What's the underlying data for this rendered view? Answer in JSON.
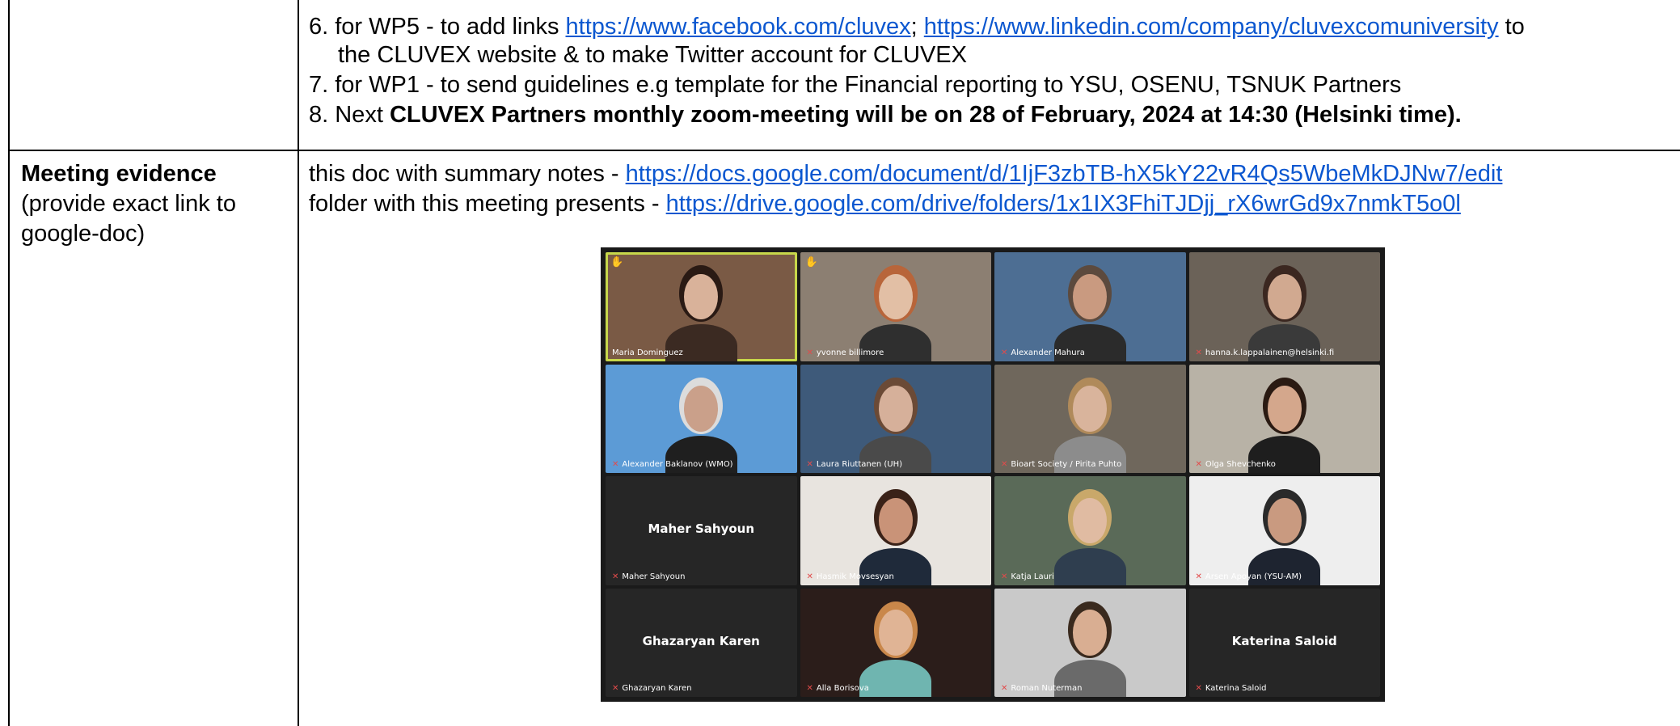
{
  "action_items": {
    "item6_prefix": "6. for WP5 - to add links ",
    "item6_link1": "https://www.facebook.com/cluvex",
    "item6_sep": "; ",
    "item6_link2": "https://www.linkedin.com/company/cluvexcomuniversity",
    "item6_suffix": " to",
    "item6_line2": "the CLUVEX website & to make Twitter account for CLUVEX",
    "item7": "7. for WP1 - to send guidelines e.g  template for the Financial reporting to YSU, OSENU, TSNUK Partners",
    "item8_prefix": "8. Next ",
    "item8_bold": "CLUVEX Partners monthly zoom-meeting will be on 28 of February, 2024 at 14:30 (Helsinki time)."
  },
  "evidence": {
    "label_bold": "Meeting evidence",
    "label_line2": "(provide exact link to",
    "label_line3": "google-doc)",
    "doc_prefix": "this doc with summary notes - ",
    "doc_link": "https://docs.google.com/document/d/1IjF3zbTB-hX5kY22vR4Qs5WbeMkDJNw7/edit",
    "folder_prefix": "folder with this meeting presents - ",
    "folder_link": "https://drive.google.com/drive/folders/1x1IX3FhiTJDjj_rX6wrGd9x7nmkT5o0l"
  },
  "zoom_participants": [
    {
      "name": "Maria Dominguez",
      "hand": true,
      "bg": "#7a5a45",
      "skin": "#d9b29a",
      "cloth": "#3b2a22",
      "hair": "#2a1a14"
    },
    {
      "name": "yvonne billimore",
      "hand": true,
      "bg": "#8c7f72",
      "skin": "#e2bfa5",
      "cloth": "#2f2f2f",
      "hair": "#b8653a"
    },
    {
      "name": "Alexander Mahura",
      "hand": false,
      "bg": "#4d6e93",
      "skin": "#c99a80",
      "cloth": "#2b2b2b",
      "hair": "#5c4a3e"
    },
    {
      "name": "hanna.k.lappalainen@helsinki.fi",
      "hand": false,
      "bg": "#6b6258",
      "skin": "#d1a990",
      "cloth": "#3a3a3a",
      "hair": "#3b2720"
    },
    {
      "name": "Alexander Baklanov (WMO)",
      "hand": false,
      "bg": "#5c9bd6",
      "skin": "#caa08a",
      "cloth": "#1f1f1f",
      "hair": "#dcdcdc"
    },
    {
      "name": "Laura Riuttanen (UH)",
      "hand": false,
      "bg": "#3e5a7a",
      "skin": "#d6b09a",
      "cloth": "#4a4a4a",
      "hair": "#6b4a36"
    },
    {
      "name": "Bioart Society / Pirita Puhto",
      "hand": false,
      "bg": "#6f675c",
      "skin": "#d9b49c",
      "cloth": "#8c8c8c",
      "hair": "#b08a5a"
    },
    {
      "name": "Olga Shevchenko",
      "hand": false,
      "bg": "#b8b2a6",
      "skin": "#d4a78c",
      "cloth": "#1e1e1e",
      "hair": "#2a1a12"
    },
    {
      "name": "Maher Sahyoun",
      "hand": false,
      "center": "Maher Sahyoun"
    },
    {
      "name": "Hasmik Movsesyan",
      "hand": false,
      "bg": "#e8e4df",
      "skin": "#c99378",
      "cloth": "#1f2a3a",
      "hair": "#3a2218"
    },
    {
      "name": "Katja Lauri",
      "hand": false,
      "bg": "#5a6a58",
      "skin": "#e0bba2",
      "cloth": "#2f3e4f",
      "hair": "#c9a86a"
    },
    {
      "name": "Arsen Apoyan (YSU-AM)",
      "hand": false,
      "bg": "#eeeeee",
      "skin": "#c99a80",
      "cloth": "#1e2430",
      "hair": "#2a2a2a"
    },
    {
      "name": "Ghazaryan Karen",
      "hand": false,
      "center": "Ghazaryan Karen"
    },
    {
      "name": "Alla Borisova",
      "hand": false,
      "bg": "#2b1d1a",
      "skin": "#e0b495",
      "cloth": "#6fb5b0",
      "hair": "#c9874a"
    },
    {
      "name": "Roman Nuterman",
      "hand": false,
      "bg": "#c9c9c9",
      "skin": "#d9ae92",
      "cloth": "#6a6a6a",
      "hair": "#3a2a1e"
    },
    {
      "name": "Katerina Saloid",
      "hand": false,
      "center": "Katerina Saloid"
    }
  ],
  "colors": {
    "link": "#0b57d0",
    "border": "#000000",
    "zoom_bg": "#1a1a1a",
    "active_speaker": "#c7d74a"
  }
}
